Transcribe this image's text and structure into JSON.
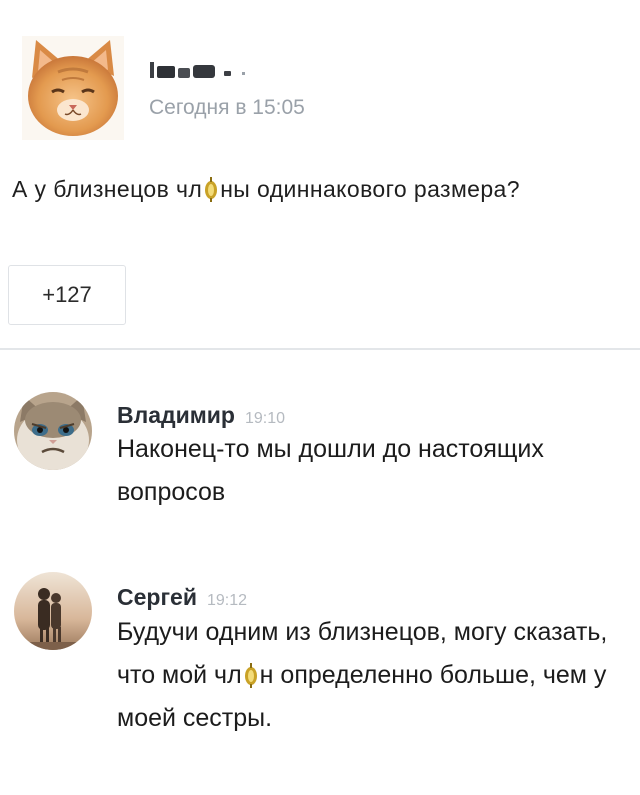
{
  "post": {
    "author_name": "",
    "timestamp": "Сегодня в 15:05",
    "text_part1": "А у близнецов чл",
    "text_part2": "ны одиннакового размера?",
    "likes": "+127",
    "avatar_icon": "cat-avatar-icon",
    "censor_icon": "spark-icon"
  },
  "comments": [
    {
      "author": "Владимир",
      "time": "19:10",
      "text": "Наконец-то мы дошли до настоящих вопросов",
      "avatar_icon": "grumpy-cat-avatar-icon"
    },
    {
      "author": "Сергей",
      "time": "19:12",
      "text_part1": "Будучи одним из близнецов, могу сказать, что мой чл",
      "text_part2": "н определенно больше, чем у моей сестры.",
      "avatar_icon": "couple-photo-avatar-icon"
    }
  ],
  "colors": {
    "timestamp": "#9aa1a9",
    "comment_time": "#b5bac0",
    "divider": "#e3e6e9",
    "spark": "#c9a227"
  }
}
